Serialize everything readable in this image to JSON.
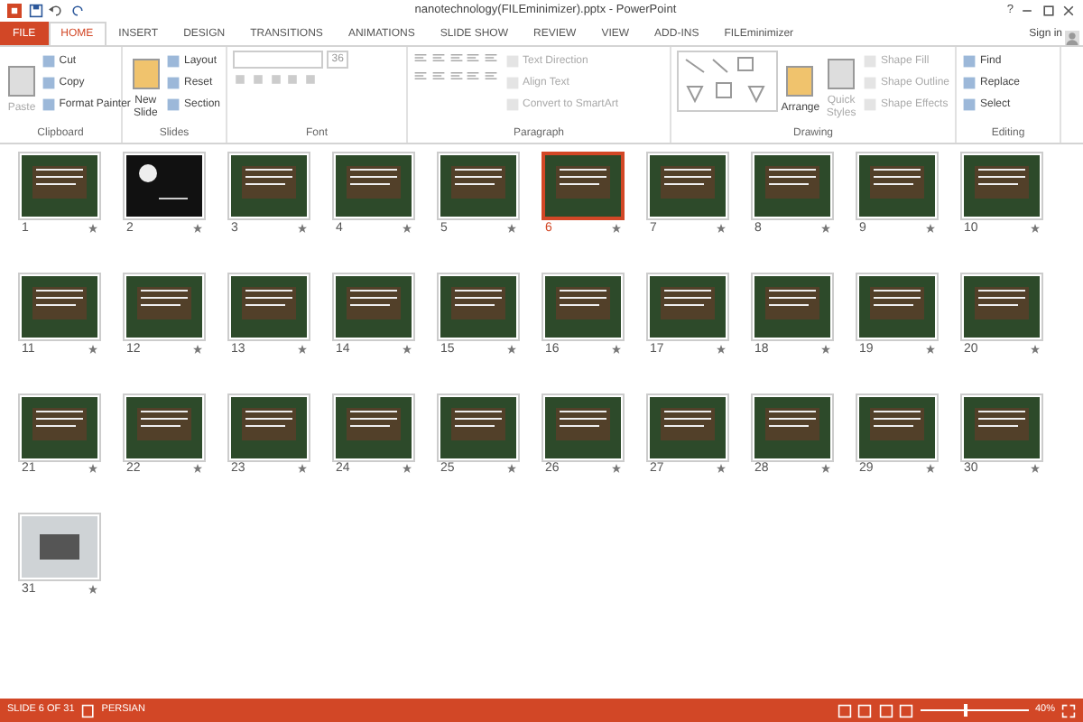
{
  "window": {
    "title": "nanotechnology(FILEminimizer).pptx - PowerPoint",
    "help": "?",
    "account": "Sign in"
  },
  "tabs": [
    {
      "label": "FILE",
      "selected": false,
      "kind": "file"
    },
    {
      "label": "HOME",
      "selected": true,
      "kind": "tab"
    },
    {
      "label": "INSERT",
      "selected": false,
      "kind": "tab"
    },
    {
      "label": "DESIGN",
      "selected": false,
      "kind": "tab"
    },
    {
      "label": "TRANSITIONS",
      "selected": false,
      "kind": "tab"
    },
    {
      "label": "ANIMATIONS",
      "selected": false,
      "kind": "tab"
    },
    {
      "label": "SLIDE SHOW",
      "selected": false,
      "kind": "tab"
    },
    {
      "label": "REVIEW",
      "selected": false,
      "kind": "tab"
    },
    {
      "label": "VIEW",
      "selected": false,
      "kind": "tab"
    },
    {
      "label": "ADD-INS",
      "selected": false,
      "kind": "tab"
    },
    {
      "label": "FILEminimizer",
      "selected": false,
      "kind": "tab"
    }
  ],
  "ribbon": {
    "groups": [
      {
        "name": "Clipboard",
        "large": [
          {
            "label": "Paste",
            "disabled": true
          }
        ],
        "small": [
          {
            "label": "Cut",
            "disabled": false
          },
          {
            "label": "Copy",
            "disabled": false
          },
          {
            "label": "Format Painter",
            "disabled": false
          }
        ]
      },
      {
        "name": "Slides",
        "large": [
          {
            "label": "New Slide",
            "disabled": false
          }
        ],
        "small": [
          {
            "label": "Layout",
            "disabled": false
          },
          {
            "label": "Reset",
            "disabled": false
          },
          {
            "label": "Section",
            "disabled": false
          }
        ]
      },
      {
        "name": "Font",
        "font_size": "36"
      },
      {
        "name": "Paragraph",
        "small": [
          {
            "label": "Text Direction",
            "disabled": true
          },
          {
            "label": "Align Text",
            "disabled": true
          },
          {
            "label": "Convert to SmartArt",
            "disabled": true
          }
        ]
      },
      {
        "name": "Drawing",
        "large": [
          {
            "label": "Arrange",
            "disabled": false
          },
          {
            "label": "Quick Styles",
            "disabled": true
          }
        ],
        "small": [
          {
            "label": "Shape Fill",
            "disabled": true
          },
          {
            "label": "Shape Outline",
            "disabled": true
          },
          {
            "label": "Shape Effects",
            "disabled": true
          }
        ]
      },
      {
        "name": "Editing",
        "small": [
          {
            "label": "Find",
            "disabled": false
          },
          {
            "label": "Replace",
            "disabled": false
          },
          {
            "label": "Select",
            "disabled": false
          }
        ]
      }
    ]
  },
  "slides": [
    {
      "number": "1",
      "selected": false,
      "kind": "green"
    },
    {
      "number": "2",
      "selected": false,
      "kind": "dark"
    },
    {
      "number": "3",
      "selected": false,
      "kind": "green"
    },
    {
      "number": "4",
      "selected": false,
      "kind": "green"
    },
    {
      "number": "5",
      "selected": false,
      "kind": "green"
    },
    {
      "number": "6",
      "selected": true,
      "kind": "green"
    },
    {
      "number": "7",
      "selected": false,
      "kind": "green"
    },
    {
      "number": "8",
      "selected": false,
      "kind": "green"
    },
    {
      "number": "9",
      "selected": false,
      "kind": "green"
    },
    {
      "number": "10",
      "selected": false,
      "kind": "green"
    },
    {
      "number": "11",
      "selected": false,
      "kind": "green"
    },
    {
      "number": "12",
      "selected": false,
      "kind": "green"
    },
    {
      "number": "13",
      "selected": false,
      "kind": "green"
    },
    {
      "number": "14",
      "selected": false,
      "kind": "green"
    },
    {
      "number": "15",
      "selected": false,
      "kind": "green"
    },
    {
      "number": "16",
      "selected": false,
      "kind": "green"
    },
    {
      "number": "17",
      "selected": false,
      "kind": "green"
    },
    {
      "number": "18",
      "selected": false,
      "kind": "green"
    },
    {
      "number": "19",
      "selected": false,
      "kind": "green"
    },
    {
      "number": "20",
      "selected": false,
      "kind": "green"
    },
    {
      "number": "21",
      "selected": false,
      "kind": "green"
    },
    {
      "number": "22",
      "selected": false,
      "kind": "green"
    },
    {
      "number": "23",
      "selected": false,
      "kind": "green"
    },
    {
      "number": "24",
      "selected": false,
      "kind": "green"
    },
    {
      "number": "25",
      "selected": false,
      "kind": "green"
    },
    {
      "number": "26",
      "selected": false,
      "kind": "green"
    },
    {
      "number": "27",
      "selected": false,
      "kind": "green"
    },
    {
      "number": "28",
      "selected": false,
      "kind": "green"
    },
    {
      "number": "29",
      "selected": false,
      "kind": "green"
    },
    {
      "number": "30",
      "selected": false,
      "kind": "green"
    },
    {
      "number": "31",
      "selected": false,
      "kind": "photo"
    }
  ],
  "status_bar": {
    "slide_info": "SLIDE 6 OF 31",
    "language": "PERSIAN",
    "zoom": {
      "level": 0.4,
      "reading": "40%"
    }
  }
}
